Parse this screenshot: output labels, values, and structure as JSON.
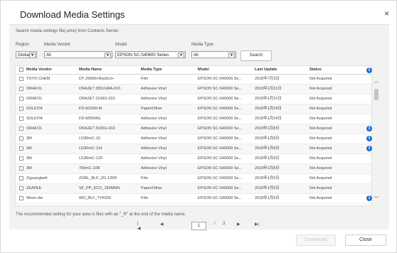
{
  "dialog": {
    "title": "Download Media Settings",
    "close_glyph": "×"
  },
  "description": "Search media settings file(.emx) from Contents Server.",
  "filters": {
    "region": {
      "label": "Region",
      "value": "Global"
    },
    "vendor": {
      "label": "Media Vendor",
      "value": "All"
    },
    "model": {
      "label": "Model",
      "value": "EPSON SC-S40600 Series"
    },
    "type": {
      "label": "Media Type",
      "value": "All"
    },
    "search_label": "Search"
  },
  "table": {
    "columns": [
      "Media Vendor",
      "Media Name",
      "Media Type",
      "Model",
      "Last Update",
      "Status"
    ],
    "info_icon": "info-icon",
    "rows": [
      {
        "vendor": "TOYO CHEM",
        "name": "DT-J996N+BackLit+",
        "type": "Film",
        "model": "EPSON SC-S40600 Se...",
        "date": "2018年7月3日",
        "status": "Not Acquired",
        "info": false
      },
      {
        "vendor": "ORAFOL",
        "name": "ORAJET 3951GRA-010",
        "type": "Adhesive Vinyl",
        "model": "EPSON SC-S40600 Se...",
        "date": "2018年1月31日",
        "status": "Not Acquired",
        "info": false
      },
      {
        "vendor": "ORAFOL",
        "name": "ORAJET 3169G-010",
        "type": "Adhesive Vinyl",
        "model": "EPSON SC-S40600 Se...",
        "date": "2018年1月31日",
        "status": "Not Acquired",
        "info": false
      },
      {
        "vendor": "SOLEITA",
        "name": "FD-M1009 M",
        "type": "Paper/Other",
        "model": "EPSON SC-S40600 Se...",
        "date": "2018年1月24日",
        "status": "Not Acquired",
        "info": false
      },
      {
        "vendor": "SOLEITA",
        "name": "FD-M5004G",
        "type": "Adhesive Vinyl",
        "model": "EPSON SC-S40600 Se...",
        "date": "2018年1月24日",
        "status": "Not Acquired",
        "info": false
      },
      {
        "vendor": "ORAFOL",
        "name": "ORAJET 3165G-010",
        "type": "Adhesive Vinyl",
        "model": "EPSON SC-S40600 Se...",
        "date": "2018年1月8日",
        "status": "Not Acquired",
        "info": true
      },
      {
        "vendor": "3M",
        "name": "IJ180mC-10",
        "type": "Adhesive Vinyl",
        "model": "EPSON SC-S40600 Se...",
        "date": "2018年1月8日",
        "status": "Not Acquired",
        "info": true
      },
      {
        "vendor": "3M",
        "name": "IJ180mC-114",
        "type": "Adhesive Vinyl",
        "model": "EPSON SC-S40600 Se...",
        "date": "2018年1月8日",
        "status": "Not Acquired",
        "info": true
      },
      {
        "vendor": "3M",
        "name": "IJ180mC-120",
        "type": "Adhesive Vinyl",
        "model": "EPSON SC-S40600 Se...",
        "date": "2018年1月8日",
        "status": "Not Acquired",
        "info": false
      },
      {
        "vendor": "3M",
        "name": "780mC-10R",
        "type": "Adhesive Vinyl",
        "model": "EPSON SC-S40600 Se...",
        "date": "2018年1月8日",
        "status": "Not Acquired",
        "info": false
      },
      {
        "vendor": "Ziguangbeili",
        "name": "ZGBL_BLF_ZG-125R",
        "type": "Film",
        "model": "EPSON SC-S40600 Se...",
        "date": "2018年1月5日",
        "status": "Not Acquired",
        "info": false
      },
      {
        "vendor": "ZEAFEE",
        "name": "SF_PP_ECO_180MNN",
        "type": "Paper/Other",
        "model": "EPSON SC-S40600 Se...",
        "date": "2018年1月5日",
        "status": "Not Acquired",
        "info": false
      },
      {
        "vendor": "Woen.der",
        "name": "WD_BLF_TYK020",
        "type": "Film",
        "model": "EPSON SC-S40600 Se...",
        "date": "2018年1月5日",
        "status": "Not Acquired",
        "info": true
      }
    ]
  },
  "pager": {
    "first": "|◀",
    "prev": "◀",
    "current": "1",
    "separator": "/",
    "total": "3",
    "next": "▶",
    "last": "▶|"
  },
  "note": "The recommended setting for your area is files with an \"_R\" at the end of the media name.",
  "buttons": {
    "download": "Download",
    "close": "Close"
  }
}
